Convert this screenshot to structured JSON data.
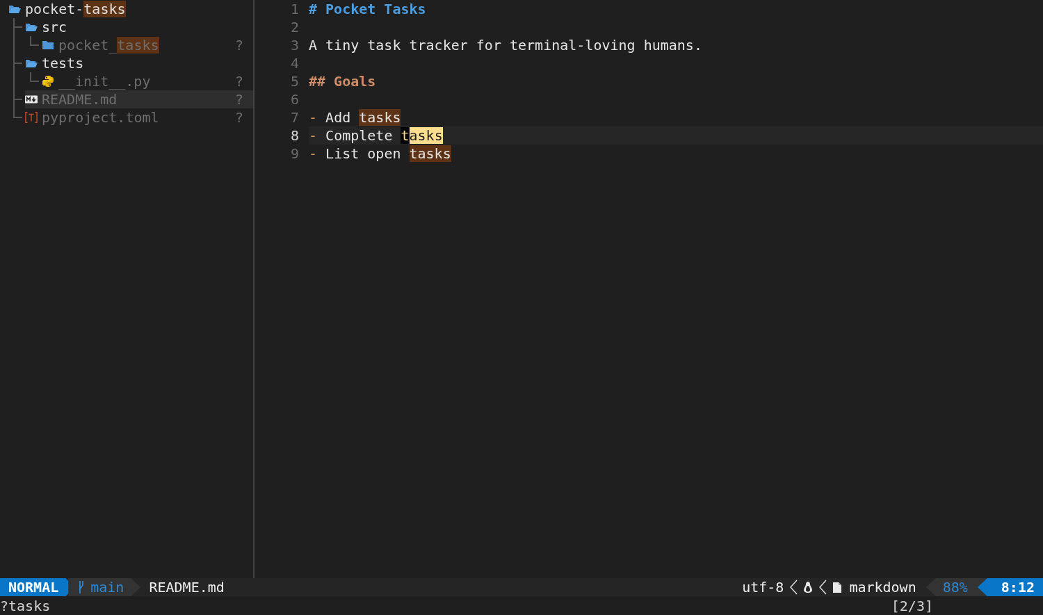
{
  "tree": {
    "name": [
      {
        "text": "pocket-"
      },
      {
        "text": "tasks",
        "kind": "match"
      }
    ],
    "kind": "folder",
    "expanded": true,
    "dimmed": false,
    "selected": false,
    "children": [
      {
        "name": [
          {
            "text": "src"
          }
        ],
        "kind": "folder",
        "expanded": true,
        "dimmed": false,
        "selected": false,
        "children": [
          {
            "name": [
              {
                "text": "pocket_"
              },
              {
                "text": "tasks",
                "kind": "match"
              }
            ],
            "kind": "folder",
            "expanded": false,
            "dimmed": true,
            "selected": false,
            "status": "?"
          }
        ]
      },
      {
        "name": [
          {
            "text": "tests"
          }
        ],
        "kind": "folder",
        "expanded": true,
        "dimmed": false,
        "selected": false,
        "children": [
          {
            "name": [
              {
                "text": "__init__.py"
              }
            ],
            "kind": "python",
            "dimmed": true,
            "selected": false,
            "status": "?"
          }
        ]
      },
      {
        "name": [
          {
            "text": "README.md"
          }
        ],
        "kind": "markdown",
        "dimmed": true,
        "selected": true,
        "status": "?"
      },
      {
        "name": [
          {
            "text": "pyproject.toml"
          }
        ],
        "kind": "toml",
        "dimmed": true,
        "selected": false,
        "status": "?"
      }
    ]
  },
  "editor": {
    "lines": [
      {
        "number": "1",
        "kind": "h1",
        "current": false,
        "segments": [
          {
            "text": "# Pocket Tasks"
          }
        ]
      },
      {
        "number": "2",
        "kind": "blank",
        "current": false
      },
      {
        "number": "3",
        "kind": "text",
        "current": false,
        "segments": [
          {
            "text": "A tiny task tracker for terminal-loving humans."
          }
        ]
      },
      {
        "number": "4",
        "kind": "blank",
        "current": false
      },
      {
        "number": "5",
        "kind": "h2",
        "current": false,
        "segments": [
          {
            "text": "## Goals"
          }
        ]
      },
      {
        "number": "6",
        "kind": "blank",
        "current": false
      },
      {
        "number": "7",
        "kind": "list",
        "current": false,
        "marker": "-",
        "segments": [
          {
            "text": " Add "
          },
          {
            "text": "tasks",
            "kind": "match"
          }
        ]
      },
      {
        "number": "8",
        "kind": "list",
        "current": true,
        "marker": "-",
        "segments": [
          {
            "text": " Complete "
          },
          {
            "text": "t",
            "kind": "cursor"
          },
          {
            "text": "asks",
            "kind": "current"
          }
        ]
      },
      {
        "number": "9",
        "kind": "list",
        "current": false,
        "marker": "-",
        "segments": [
          {
            "text": " List open "
          },
          {
            "text": "tasks",
            "kind": "match"
          }
        ]
      }
    ]
  },
  "status_bar": {
    "mode": "NORMAL",
    "branch": "main",
    "file": "README.md",
    "encoding": "utf-8",
    "filetype": "markdown",
    "progress": "88%",
    "position": "8:12"
  },
  "command_line": {
    "text": "?tasks",
    "search_count": "[2/3]"
  }
}
